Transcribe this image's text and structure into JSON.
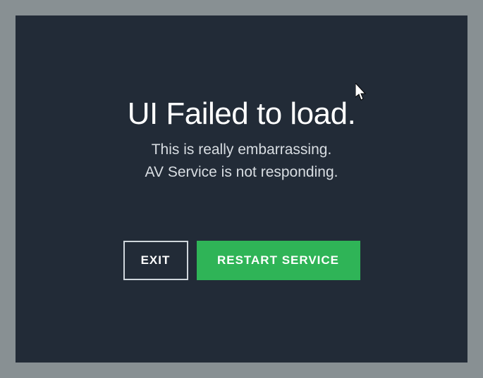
{
  "error": {
    "title": "UI Failed to load.",
    "line1": "This is really embarrassing.",
    "line2": "AV Service is not responding."
  },
  "buttons": {
    "exit": "EXIT",
    "restart": "RESTART SERVICE"
  }
}
